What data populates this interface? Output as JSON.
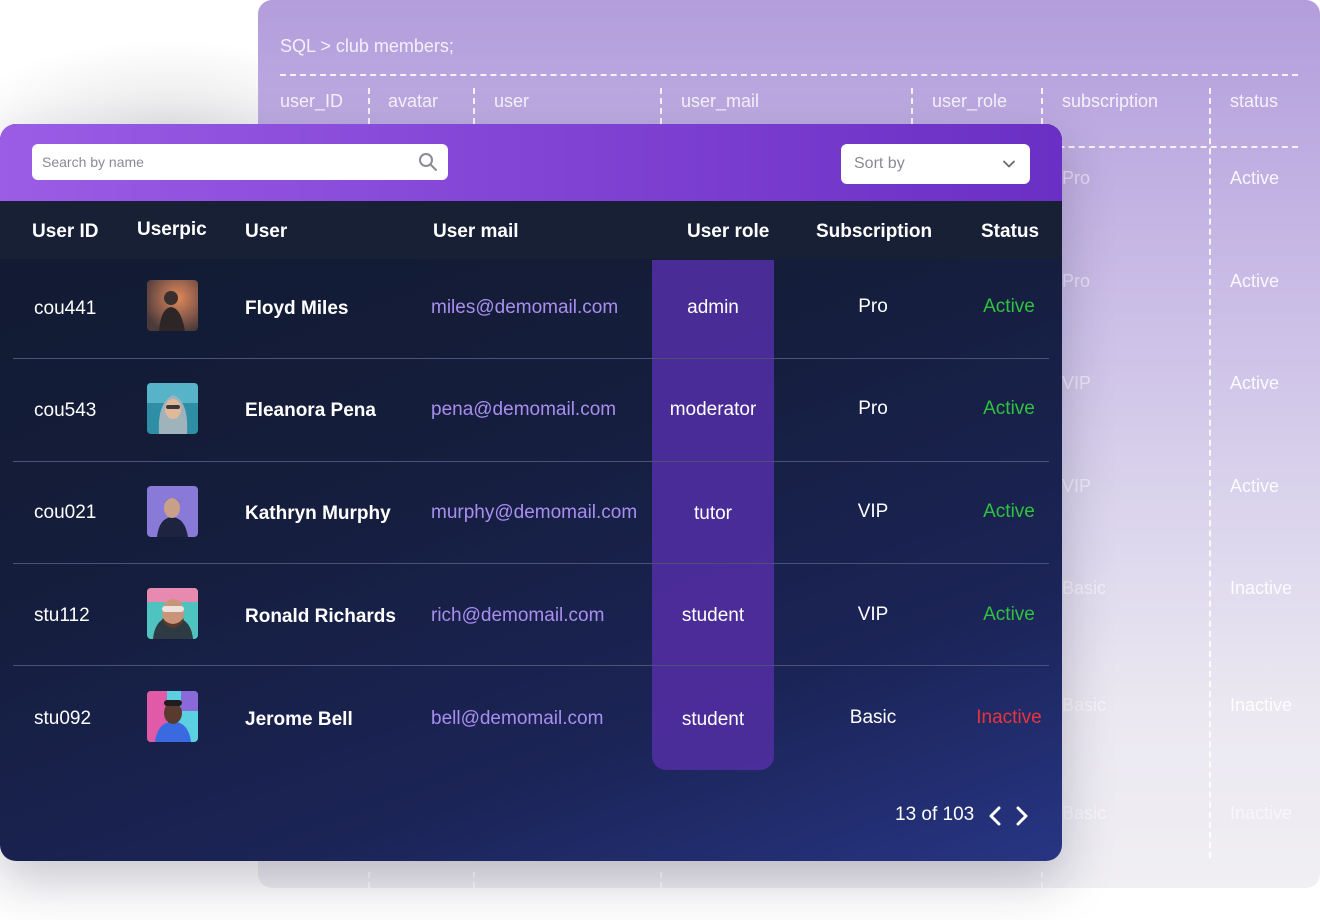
{
  "sql_panel": {
    "title": "SQL > club members;",
    "columns": [
      "user_ID",
      "avatar",
      "user",
      "user_mail",
      "user_role",
      "subscription",
      "status"
    ],
    "rows": [
      {
        "subscription": "Pro",
        "status": "Active"
      },
      {
        "subscription": "Pro",
        "status": "Active"
      },
      {
        "subscription": "VIP",
        "status": "Active"
      },
      {
        "subscription": "VIP",
        "status": "Active"
      },
      {
        "subscription": "Basic",
        "status": "Inactive"
      },
      {
        "subscription": "Basic",
        "status": "Inactive"
      },
      {
        "subscription": "Basic",
        "status": "Inactive"
      }
    ]
  },
  "toolbar": {
    "search_placeholder": "Search by name",
    "sort_label": "Sort by"
  },
  "table": {
    "headers": {
      "user_id": "User ID",
      "userpic": "Userpic",
      "user": "User",
      "user_mail": "User mail",
      "user_role": "User role",
      "subscription": "Subscription",
      "status": "Status"
    },
    "rows": [
      {
        "id": "cou441",
        "name": "Floyd Miles",
        "mail": "miles@demomail.com",
        "role": "admin",
        "subscription": "Pro",
        "status": "Active"
      },
      {
        "id": "cou543",
        "name": "Eleanora Pena",
        "mail": "pena@demomail.com",
        "role": "moderator",
        "subscription": "Pro",
        "status": "Active"
      },
      {
        "id": "cou021",
        "name": "Kathryn Murphy",
        "mail": "murphy@demomail.com",
        "role": "tutor",
        "subscription": "VIP",
        "status": "Active"
      },
      {
        "id": "stu112",
        "name": "Ronald Richards",
        "mail": "rich@demomail.com",
        "role": "student",
        "subscription": "VIP",
        "status": "Active"
      },
      {
        "id": "stu092",
        "name": "Jerome Bell",
        "mail": "bell@demomail.com",
        "role": "student",
        "subscription": "Basic",
        "status": "Inactive"
      }
    ]
  },
  "pagination": {
    "label": "13 of 103"
  },
  "colors": {
    "active": "#2fc23f",
    "inactive": "#e8343a",
    "mail": "#a98ef0",
    "accent": "#8446d6"
  },
  "icons": {
    "search": "search-icon",
    "sort": "chevron-down-icon",
    "prev": "chevron-left-icon",
    "next": "chevron-right-icon"
  }
}
